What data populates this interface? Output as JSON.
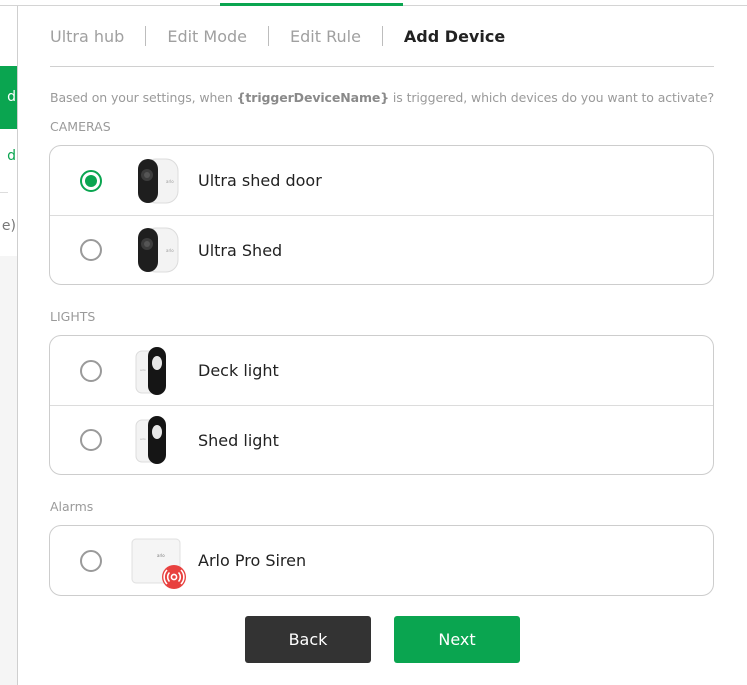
{
  "sidebar": {
    "active_item_fragment": "d",
    "item2_fragment": "d",
    "item3_fragment": "e)"
  },
  "breadcrumbs": [
    {
      "label": "Ultra hub",
      "current": false
    },
    {
      "label": "Edit Mode",
      "current": false
    },
    {
      "label": "Edit Rule",
      "current": false
    },
    {
      "label": "Add Device",
      "current": true
    }
  ],
  "prompt": {
    "before": "Based on your settings, when ",
    "trigger": "{triggerDeviceName}",
    "after": " is triggered, which devices do you want to activate?"
  },
  "sections": [
    {
      "label": "CAMERAS",
      "devices": [
        {
          "name": "Ultra shed door",
          "icon": "camera-icon",
          "selected": true
        },
        {
          "name": "Ultra Shed",
          "icon": "camera-icon",
          "selected": false
        }
      ]
    },
    {
      "label": "LIGHTS",
      "devices": [
        {
          "name": "Deck light",
          "icon": "light-icon",
          "selected": false
        },
        {
          "name": "Shed light",
          "icon": "light-icon",
          "selected": false
        }
      ]
    },
    {
      "label": "Alarms",
      "devices": [
        {
          "name": "Arlo Pro Siren",
          "icon": "siren-icon",
          "selected": false
        }
      ]
    }
  ],
  "buttons": {
    "back": "Back",
    "next": "Next"
  },
  "colors": {
    "accent": "#0aa550",
    "back_button": "#333333",
    "siren_badge": "#e8413f"
  }
}
